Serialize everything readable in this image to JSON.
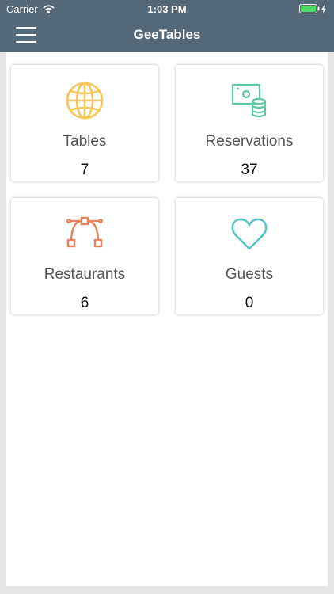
{
  "status_bar": {
    "carrier": "Carrier",
    "time": "1:03 PM",
    "wifi_icon": "wifi-icon",
    "battery_icon": "battery-icon"
  },
  "nav": {
    "title": "GeeTables",
    "menu_icon": "hamburger-menu-icon",
    "background_color": "#546878"
  },
  "cards": [
    {
      "label": "Tables",
      "count": "7",
      "icon": "globe-icon",
      "color": "#f5c65a"
    },
    {
      "label": "Reservations",
      "count": "37",
      "icon": "money-database-icon",
      "color": "#5cc8a1"
    },
    {
      "label": "Restaurants",
      "count": "6",
      "icon": "vector-path-icon",
      "color": "#e8825c"
    },
    {
      "label": "Guests",
      "count": "0",
      "icon": "heart-icon",
      "color": "#5ac3c8"
    }
  ]
}
